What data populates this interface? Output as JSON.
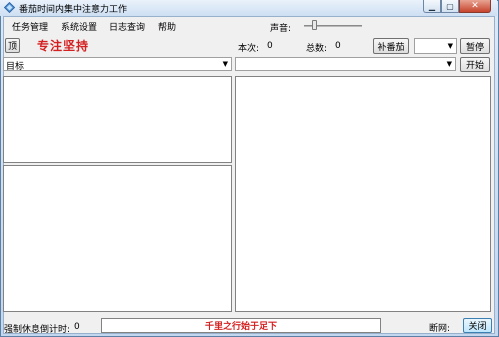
{
  "window": {
    "title": "番茄时间内集中注意力工作"
  },
  "menu": {
    "items": [
      {
        "label": "任务管理"
      },
      {
        "label": "系统设置"
      },
      {
        "label": "日志查询"
      },
      {
        "label": "帮助"
      }
    ]
  },
  "toolbar": {
    "volume_label": "声音:",
    "top_button_label": "顶",
    "focus_text": "专注坚持",
    "current_label": "本次:",
    "current_value": "0",
    "total_label": "总数:",
    "total_value": "0",
    "add_tomato_label": "补番茄",
    "pause_label": "暂停"
  },
  "selectors": {
    "target_label": "目标",
    "start_label": "开始"
  },
  "status": {
    "force_rest_label": "强制休息倒计时:",
    "force_rest_value": "0",
    "motto": "千里之行始于足下",
    "network_label": "断网:",
    "close_label": "关闭"
  },
  "icons": {
    "app": "tomato-app-icon",
    "minimize": "minimize-icon",
    "maximize": "maximize-icon",
    "close": "close-icon",
    "dropdown": "chevron-down-icon"
  },
  "colors": {
    "accent_red": "#d42020"
  }
}
